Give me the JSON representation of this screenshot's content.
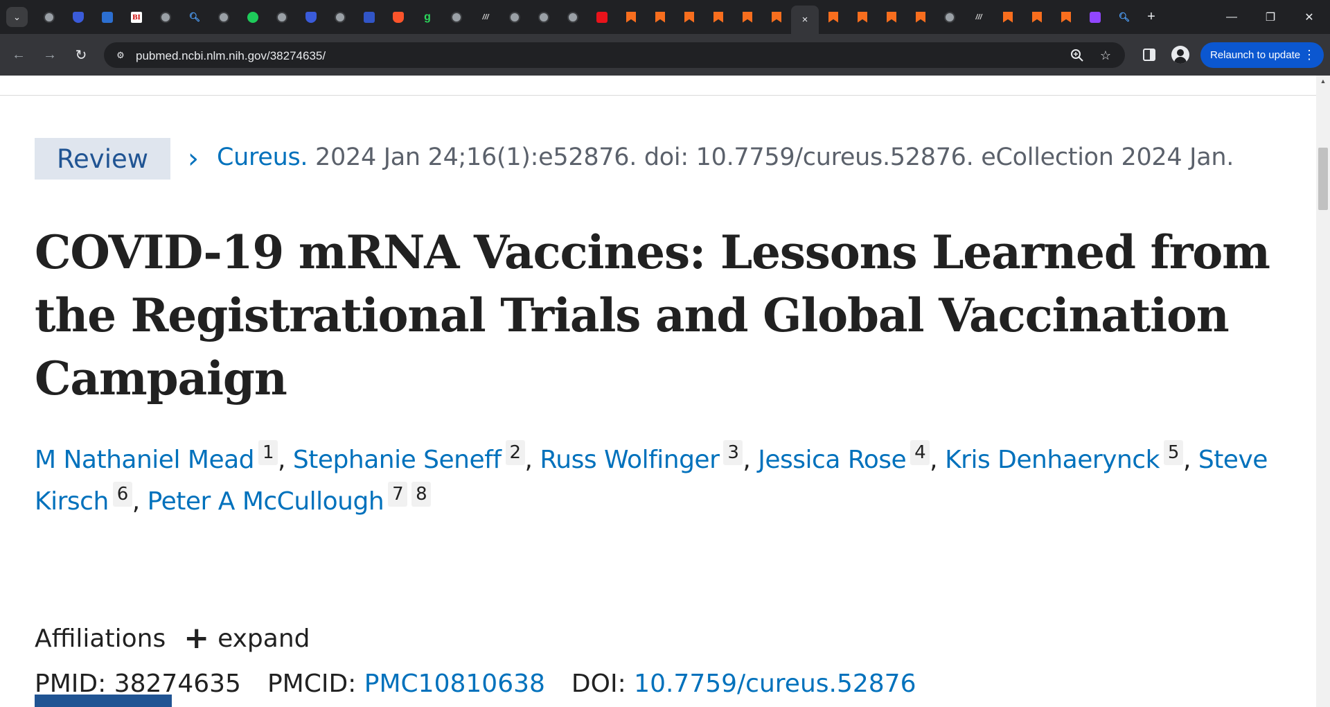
{
  "browser": {
    "active_tab_close": "×",
    "new_tab": "+",
    "window_controls": {
      "minimize": "—",
      "restore": "❐",
      "close": "✕"
    },
    "url": "pubmed.ncbi.nlm.nih.gov/38274635/",
    "relaunch_label": "Relaunch to update",
    "tabs": [
      {
        "icon": "globe-icon"
      },
      {
        "icon": "shield-icon"
      },
      {
        "icon": "chevron-icon"
      },
      {
        "icon": "bi-icon",
        "text": "BI"
      },
      {
        "icon": "globe-icon"
      },
      {
        "icon": "search-icon"
      },
      {
        "icon": "globe-icon"
      },
      {
        "icon": "play-icon"
      },
      {
        "icon": "globe-icon"
      },
      {
        "icon": "shield-icon"
      },
      {
        "icon": "globe-icon"
      },
      {
        "icon": "cube-icon"
      },
      {
        "icon": "brave-icon"
      },
      {
        "icon": "g-icon",
        "text": "g"
      },
      {
        "icon": "globe-icon"
      },
      {
        "icon": "slash-icon",
        "text": "///"
      },
      {
        "icon": "globe-icon"
      },
      {
        "icon": "globe-icon"
      },
      {
        "icon": "globe-icon"
      },
      {
        "icon": "red-icon"
      },
      {
        "icon": "bookmark-icon"
      },
      {
        "icon": "bookmark-icon"
      },
      {
        "icon": "bookmark-icon"
      },
      {
        "icon": "bookmark-icon"
      },
      {
        "icon": "bookmark-icon"
      },
      {
        "icon": "bookmark-icon"
      },
      {
        "icon": "active-tab"
      },
      {
        "icon": "bookmark-icon"
      },
      {
        "icon": "bookmark-icon"
      },
      {
        "icon": "bookmark-icon"
      },
      {
        "icon": "bookmark-icon"
      },
      {
        "icon": "globe-icon"
      },
      {
        "icon": "slash-icon",
        "text": "///"
      },
      {
        "icon": "bookmark-icon"
      },
      {
        "icon": "bookmark-icon"
      },
      {
        "icon": "bookmark-icon"
      },
      {
        "icon": "twitch-icon"
      },
      {
        "icon": "search-icon"
      }
    ]
  },
  "article": {
    "type_badge": "Review",
    "journal": "Cureus.",
    "citation": " 2024 Jan 24;16(1):e52876. doi: 10.7759/cureus.52876. eCollection 2024 Jan.",
    "title": "COVID-19 mRNA Vaccines: Lessons Learned from the Registrational Trials and Global Vaccination Campaign",
    "authors": [
      {
        "name": "M Nathaniel Mead",
        "affs": [
          "1"
        ]
      },
      {
        "name": "Stephanie Seneff",
        "affs": [
          "2"
        ]
      },
      {
        "name": "Russ Wolfinger",
        "affs": [
          "3"
        ]
      },
      {
        "name": "Jessica Rose",
        "affs": [
          "4"
        ]
      },
      {
        "name": "Kris Denhaerynck",
        "affs": [
          "5"
        ]
      },
      {
        "name": "Steve Kirsch",
        "affs": [
          "6"
        ]
      },
      {
        "name": "Peter A McCullough",
        "affs": [
          "7",
          "8"
        ]
      }
    ],
    "affiliations_label": "Affiliations",
    "expand_label": "expand",
    "pmid_label": "PMID:",
    "pmid": "38274635",
    "pmcid_label": "PMCID:",
    "pmcid": "PMC10810638",
    "doi_label": "DOI:",
    "doi": "10.7759/cureus.52876"
  }
}
